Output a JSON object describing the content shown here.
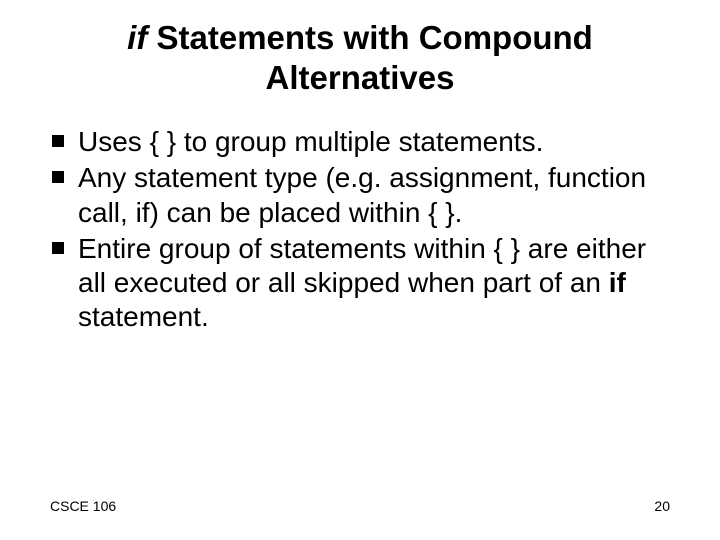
{
  "title": {
    "prefix_italic": "if",
    "rest": " Statements with Compound Alternatives"
  },
  "bullets": [
    {
      "text": "Uses { } to group multiple statements."
    },
    {
      "text": "Any statement type (e.g. assignment, function call, if) can be placed within { }."
    },
    {
      "pre": "Entire group of statements within { } are either all executed or all skipped when part of an ",
      "bold": "if",
      "post": " statement."
    }
  ],
  "footer": {
    "left": "CSCE 106",
    "right": "20"
  }
}
